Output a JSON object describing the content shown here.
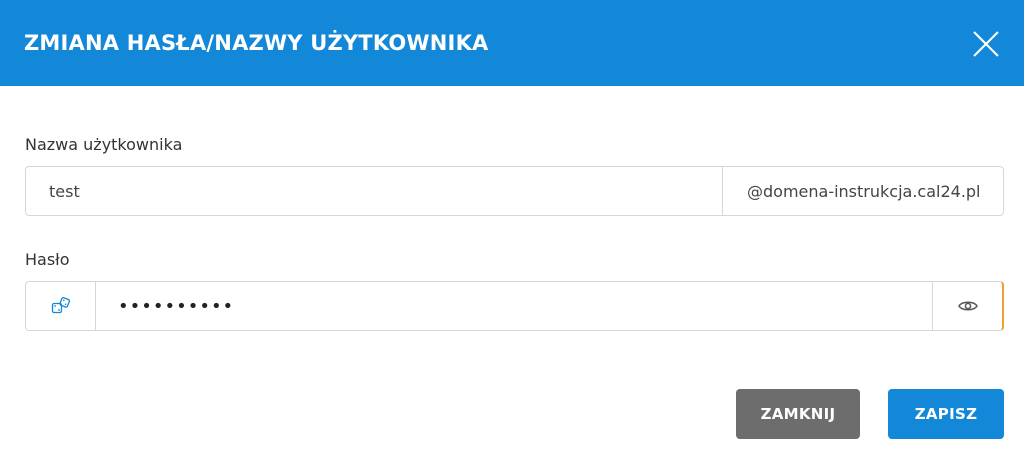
{
  "header": {
    "title": "ZMIANA HASŁA/NAZWY UŻYTKOWNIKA",
    "close_icon": "close-icon"
  },
  "username": {
    "label": "Nazwa użytkownika",
    "value": "test",
    "domain": "@domena-instrukcja.cal24.pl"
  },
  "password": {
    "label": "Hasło",
    "value": "••••••••••",
    "generate_icon": "dice-icon",
    "toggle_icon": "eye-icon"
  },
  "actions": {
    "close_label": "ZAMKNIJ",
    "save_label": "ZAPISZ"
  },
  "colors": {
    "primary": "#1488d8",
    "secondary_button": "#6d6d6d",
    "focus_accent": "#f0a030"
  }
}
